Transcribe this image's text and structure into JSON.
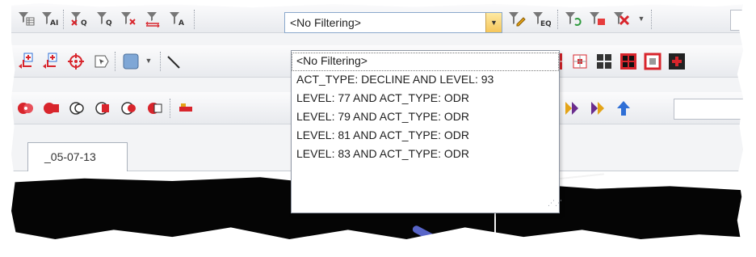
{
  "filter_combo": {
    "value": "<No Filtering>",
    "options": [
      "<No Filtering>",
      "ACT_TYPE: DECLINE AND LEVEL: 93",
      "LEVEL: 77 AND ACT_TYPE: ODR",
      "LEVEL: 79 AND ACT_TYPE: ODR",
      "LEVEL: 81 AND ACT_TYPE: ODR",
      "LEVEL: 83 AND ACT_TYPE: ODR"
    ]
  },
  "tab": {
    "label": "_05-07-13"
  },
  "colors": {
    "dropdown_arrow": "#f6c65a",
    "toolbar_bg": "#e8eaee",
    "accent_blue": "#2f6fd6",
    "accent_red": "#d8252c"
  }
}
